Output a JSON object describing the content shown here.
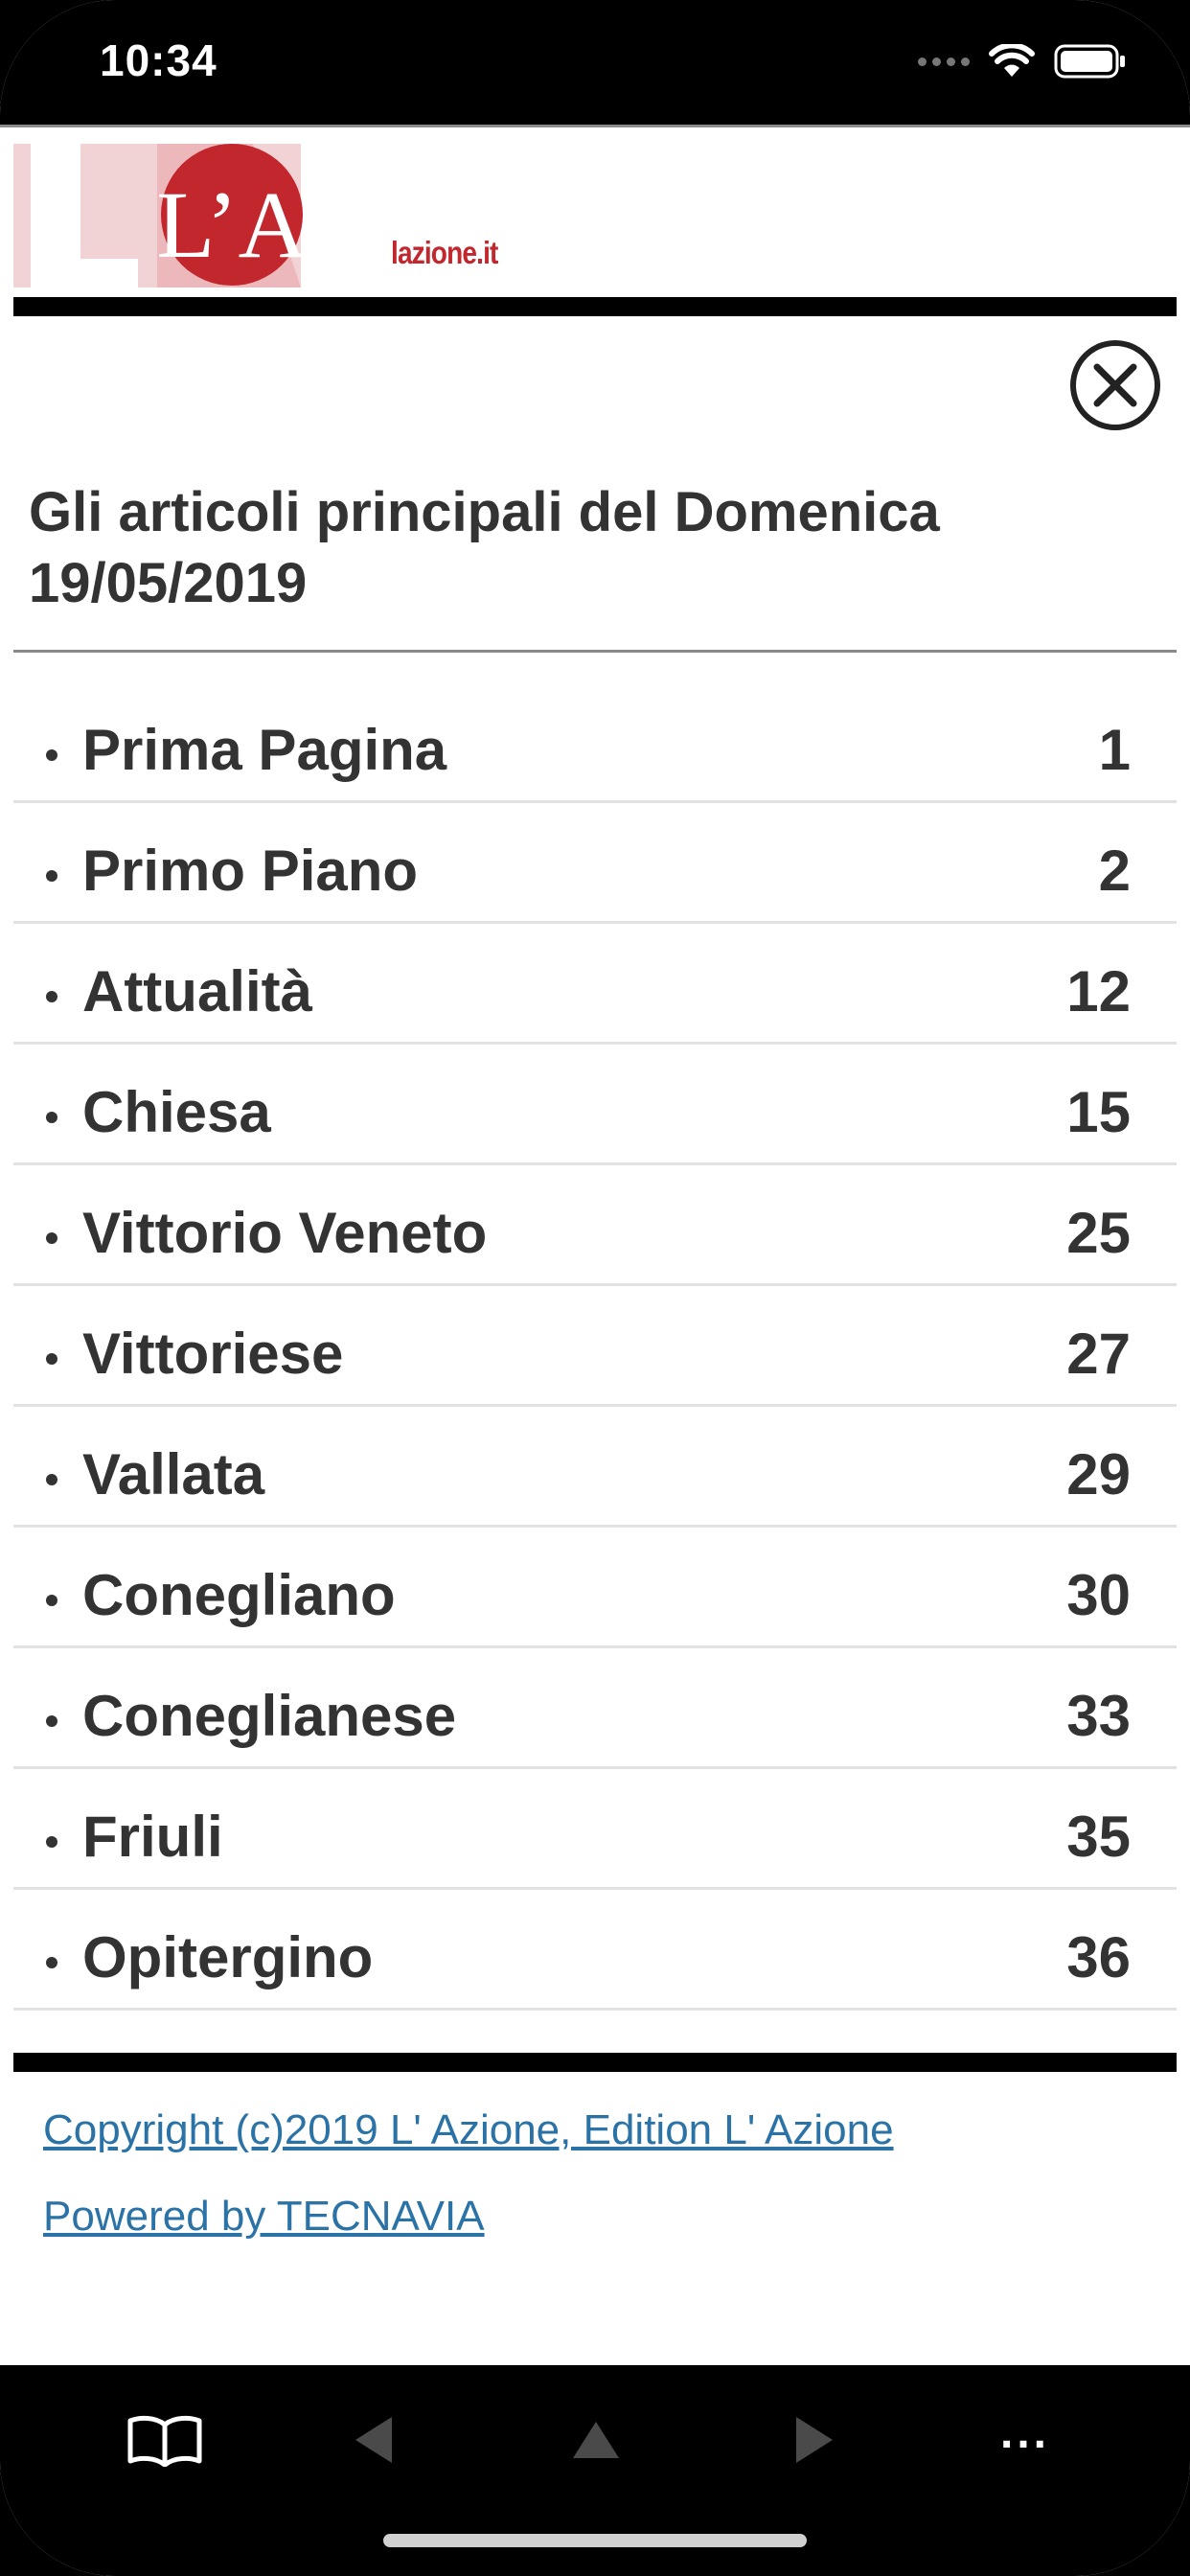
{
  "status_bar": {
    "time": "10:34"
  },
  "header": {
    "logo_text": "L’A",
    "site_label": "lazione.it"
  },
  "close_label": "Close",
  "title": "Gli articoli principali del Domenica 19/05/2019",
  "sections": [
    {
      "label": "Prima Pagina",
      "page": "1"
    },
    {
      "label": "Primo Piano",
      "page": "2"
    },
    {
      "label": "Attualità",
      "page": "12"
    },
    {
      "label": "Chiesa",
      "page": "15"
    },
    {
      "label": "Vittorio Veneto",
      "page": "25"
    },
    {
      "label": "Vittoriese",
      "page": "27"
    },
    {
      "label": "Vallata",
      "page": "29"
    },
    {
      "label": "Conegliano",
      "page": "30"
    },
    {
      "label": "Coneglianese",
      "page": "33"
    },
    {
      "label": "Friuli",
      "page": "35"
    },
    {
      "label": "Opitergino",
      "page": "36"
    }
  ],
  "footer": {
    "copyright": "Copyright (c)2019 L' Azione, Edition L' Azione",
    "powered_by": "Powered by TECNAVIA"
  },
  "toolbar": {
    "more_label": "...",
    "icons": [
      "book-icon",
      "arrow-left-icon",
      "arrow-up-icon",
      "arrow-right-icon",
      "more-icon"
    ]
  },
  "colors": {
    "brand_red": "#c1272d",
    "link_blue": "#2b73a6",
    "text_dark": "#333333"
  }
}
